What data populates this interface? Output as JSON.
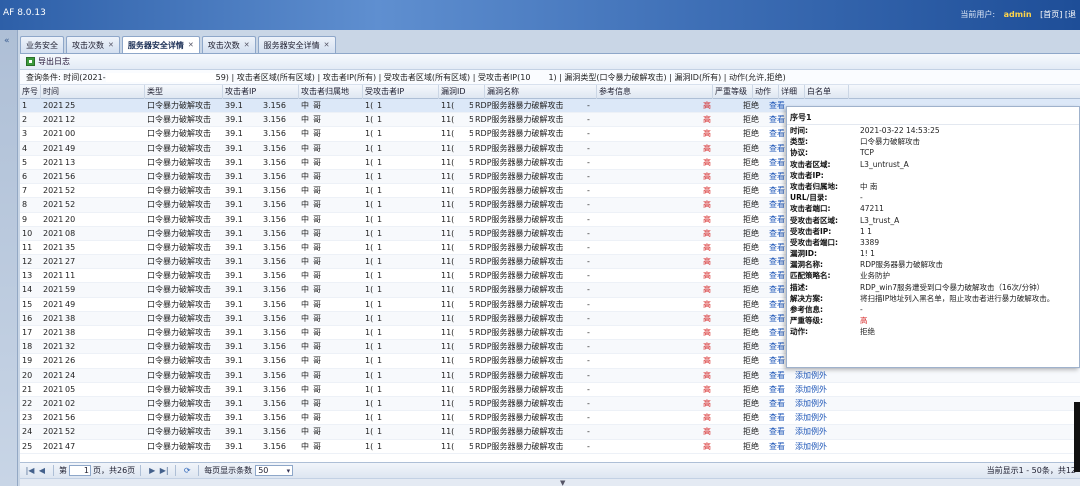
{
  "app": {
    "title": "AF 8.0.13"
  },
  "user_bar": {
    "label": "当前用户:",
    "user": "admin",
    "home": "[首页]",
    "more": "[退"
  },
  "nav": {
    "collapse": "«"
  },
  "tabs": [
    {
      "label": "业务安全",
      "closable": false,
      "active": false
    },
    {
      "label": "攻击次数",
      "closable": true,
      "active": false
    },
    {
      "label": "服务器安全详情",
      "closable": true,
      "active": true
    },
    {
      "label": "攻击次数",
      "closable": true,
      "active": false
    },
    {
      "label": "服务器安全详情",
      "closable": true,
      "active": false
    }
  ],
  "toolbar": {
    "export_label": "导出日志"
  },
  "query": {
    "prefix": "查询条件: 时间(2021-",
    "rest": "59) | 攻击者区域(所有区域) | 攻击者IP(所有) | 受攻击者区域(所有区域) | 受攻击者IP(10",
    "tail": "1) | 漏洞类型(口令暴力破解攻击) | 漏洞ID(所有) | 动作(允许,拒绝)"
  },
  "columns": [
    "序号",
    "时间",
    "类型",
    "攻击者IP",
    "攻击者归属地",
    "受攻击者IP",
    "漏洞ID",
    "漏洞名称",
    "参考信息",
    "严重等级",
    "动作",
    "详细",
    "白名单"
  ],
  "rows": [
    [
      "1",
      "2021-",
      "25",
      "口令暴力破解攻击",
      "39.1",
      "3.156",
      "中",
      "哥",
      "1(",
      "1",
      "11(",
      "51",
      "RDP服务器暴力破解攻击",
      "-",
      "高",
      "拒绝",
      "查看",
      ""
    ],
    [
      "2",
      "2021-",
      "12",
      "口令暴力破解攻击",
      "39.1",
      "3.156",
      "中",
      "哥",
      "1(",
      "1",
      "11(",
      "51",
      "RDP服务器暴力破解攻击",
      "-",
      "高",
      "拒绝",
      "查看",
      ""
    ],
    [
      "3",
      "2021-",
      "00",
      "口令暴力破解攻击",
      "39.1",
      "3.156",
      "中",
      "哥",
      "1(",
      "1",
      "11(",
      "51",
      "RDP服务器暴力破解攻击",
      "-",
      "高",
      "拒绝",
      "查看",
      ""
    ],
    [
      "4",
      "2021-",
      "49",
      "口令暴力破解攻击",
      "39.1",
      "3.156",
      "中",
      "哥",
      "1(",
      "1",
      "11(",
      "51",
      "RDP服务器暴力破解攻击",
      "-",
      "高",
      "拒绝",
      "查看",
      ""
    ],
    [
      "5",
      "2021-",
      "13",
      "口令暴力破解攻击",
      "39.1",
      "3.156",
      "中",
      "哥",
      "1(",
      "1",
      "11(",
      "51",
      "RDP服务器暴力破解攻击",
      "-",
      "高",
      "拒绝",
      "查看",
      ""
    ],
    [
      "6",
      "2021-",
      "56",
      "口令暴力破解攻击",
      "39.1",
      "3.156",
      "中",
      "哥",
      "1(",
      "1",
      "11(",
      "51",
      "RDP服务器暴力破解攻击",
      "-",
      "高",
      "拒绝",
      "查看",
      ""
    ],
    [
      "7",
      "2021-",
      "52",
      "口令暴力破解攻击",
      "39.1",
      "3.156",
      "中",
      "哥",
      "1(",
      "1",
      "11(",
      "51",
      "RDP服务器暴力破解攻击",
      "-",
      "高",
      "拒绝",
      "查看",
      ""
    ],
    [
      "8",
      "2021-",
      "52",
      "口令暴力破解攻击",
      "39.1",
      "3.156",
      "中",
      "哥",
      "1(",
      "1",
      "11(",
      "51",
      "RDP服务器暴力破解攻击",
      "-",
      "高",
      "拒绝",
      "查看",
      ""
    ],
    [
      "9",
      "2021-",
      "20",
      "口令暴力破解攻击",
      "39.1",
      "3.156",
      "中",
      "哥",
      "1(",
      "1",
      "11(",
      "51",
      "RDP服务器暴力破解攻击",
      "-",
      "高",
      "拒绝",
      "查看",
      ""
    ],
    [
      "10",
      "2021-",
      "08",
      "口令暴力破解攻击",
      "39.1",
      "3.156",
      "中",
      "哥",
      "1(",
      "1",
      "11(",
      "51",
      "RDP服务器暴力破解攻击",
      "-",
      "高",
      "拒绝",
      "查看",
      ""
    ],
    [
      "11",
      "2021-",
      "35",
      "口令暴力破解攻击",
      "39.1",
      "3.156",
      "中",
      "哥",
      "1(",
      "1",
      "11(",
      "51",
      "RDP服务器暴力破解攻击",
      "-",
      "高",
      "拒绝",
      "查看",
      ""
    ],
    [
      "12",
      "2021-",
      "27",
      "口令暴力破解攻击",
      "39.1",
      "3.156",
      "中",
      "哥",
      "1(",
      "1",
      "11(",
      "51",
      "RDP服务器暴力破解攻击",
      "-",
      "高",
      "拒绝",
      "查看",
      ""
    ],
    [
      "13",
      "2021-",
      "11",
      "口令暴力破解攻击",
      "39.1",
      "3.156",
      "中",
      "哥",
      "1(",
      "1",
      "11(",
      "51",
      "RDP服务器暴力破解攻击",
      "-",
      "高",
      "拒绝",
      "查看",
      ""
    ],
    [
      "14",
      "2021-",
      "59",
      "口令暴力破解攻击",
      "39.1",
      "3.156",
      "中",
      "哥",
      "1(",
      "1",
      "11(",
      "51",
      "RDP服务器暴力破解攻击",
      "-",
      "高",
      "拒绝",
      "查看",
      ""
    ],
    [
      "15",
      "2021-",
      "49",
      "口令暴力破解攻击",
      "39.1",
      "3.156",
      "中",
      "哥",
      "1(",
      "1",
      "11(",
      "51",
      "RDP服务器暴力破解攻击",
      "-",
      "高",
      "拒绝",
      "查看",
      ""
    ],
    [
      "16",
      "2021-",
      "38",
      "口令暴力破解攻击",
      "39.1",
      "3.156",
      "中",
      "哥",
      "1(",
      "1",
      "11(",
      "51",
      "RDP服务器暴力破解攻击",
      "-",
      "高",
      "拒绝",
      "查看",
      ""
    ],
    [
      "17",
      "2021-",
      "38",
      "口令暴力破解攻击",
      "39.1",
      "3.156",
      "中",
      "哥",
      "1(",
      "1",
      "11(",
      "51",
      "RDP服务器暴力破解攻击",
      "-",
      "高",
      "拒绝",
      "查看",
      ""
    ],
    [
      "18",
      "2021-",
      "32",
      "口令暴力破解攻击",
      "39.1",
      "3.156",
      "中",
      "哥",
      "1(",
      "1",
      "11(",
      "51",
      "RDP服务器暴力破解攻击",
      "-",
      "高",
      "拒绝",
      "查看",
      ""
    ],
    [
      "19",
      "2021-",
      "26",
      "口令暴力破解攻击",
      "39.1",
      "3.156",
      "中",
      "哥",
      "1(",
      "1",
      "11(",
      "51",
      "RDP服务器暴力破解攻击",
      "-",
      "高",
      "拒绝",
      "查看",
      ""
    ],
    [
      "20",
      "2021-",
      "24",
      "口令暴力破解攻击",
      "39.1",
      "3.156",
      "中",
      "哥",
      "1(",
      "1",
      "11(",
      "51",
      "RDP服务器暴力破解攻击",
      "-",
      "高",
      "拒绝",
      "查看",
      "添加例外"
    ],
    [
      "21",
      "2021-",
      "05",
      "口令暴力破解攻击",
      "39.1",
      "3.156",
      "中",
      "哥",
      "1(",
      "1",
      "11(",
      "51",
      "RDP服务器暴力破解攻击",
      "-",
      "高",
      "拒绝",
      "查看",
      "添加例外"
    ],
    [
      "22",
      "2021-",
      "02",
      "口令暴力破解攻击",
      "39.1",
      "3.156",
      "中",
      "哥",
      "1(",
      "1",
      "11(",
      "51",
      "RDP服务器暴力破解攻击",
      "-",
      "高",
      "拒绝",
      "查看",
      "添加例外"
    ],
    [
      "23",
      "2021-",
      "56",
      "口令暴力破解攻击",
      "39.1",
      "3.156",
      "中",
      "哥",
      "1(",
      "1",
      "11(",
      "51",
      "RDP服务器暴力破解攻击",
      "-",
      "高",
      "拒绝",
      "查看",
      "添加例外"
    ],
    [
      "24",
      "2021-",
      "52",
      "口令暴力破解攻击",
      "39.1",
      "3.156",
      "中",
      "哥",
      "1(",
      "1",
      "11(",
      "51",
      "RDP服务器暴力破解攻击",
      "-",
      "高",
      "拒绝",
      "查看",
      "添加例外"
    ],
    [
      "25",
      "2021-",
      "47",
      "口令暴力破解攻击",
      "39.1",
      "3.156",
      "中",
      "哥",
      "1(",
      "1",
      "11(",
      "51",
      "RDP服务器暴力破解攻击",
      "-",
      "高",
      "拒绝",
      "查看",
      "添加例外"
    ]
  ],
  "pager": {
    "first": "|◀",
    "prev": "◀",
    "page_prefix": "第",
    "page_value": "1",
    "page_suffix": "页，共26页",
    "next": "▶",
    "last": "▶|",
    "refresh": "⟳",
    "size_label": "每页显示条数",
    "size_value": "50",
    "status": "当前显示1 - 50条，共12"
  },
  "detail": {
    "title": "序号1",
    "fields": [
      {
        "label": "时间:",
        "value": "2021-03-22 14:53:25"
      },
      {
        "label": "类型:",
        "value": "口令暴力破解攻击"
      },
      {
        "label": "协议:",
        "value": "TCP"
      },
      {
        "label": "攻击者区域:",
        "value": "L3_untrust_A"
      },
      {
        "label": "攻击者IP:",
        "value": ""
      },
      {
        "label": "攻击者归属地:",
        "value": "中    南"
      },
      {
        "label": "URL/目录:",
        "value": "-"
      },
      {
        "label": "攻击者端口:",
        "value": "47211"
      },
      {
        "label": "受攻击者区域:",
        "value": "L3_trust_A"
      },
      {
        "label": "受攻击者IP:",
        "value": "1        1"
      },
      {
        "label": "受攻击者端口:",
        "value": "3389"
      },
      {
        "label": "漏洞ID:",
        "value": "1!        1"
      },
      {
        "label": "漏洞名称:",
        "value": "RDP服务器暴力破解攻击"
      },
      {
        "label": "匹配策略名:",
        "value": "业务防护"
      },
      {
        "label": "描述:",
        "value": "RDP_win7服务遭受到口令暴力破解攻击（16次/分钟）"
      },
      {
        "label": "解决方案:",
        "value": "将扫描IP地址列入黑名单，阻止攻击者进行暴力破解攻击。"
      },
      {
        "label": "参考信息:",
        "value": "-"
      },
      {
        "label": "严重等级:",
        "value": "高",
        "red": true
      },
      {
        "label": "动作:",
        "value": "拒绝"
      }
    ]
  }
}
